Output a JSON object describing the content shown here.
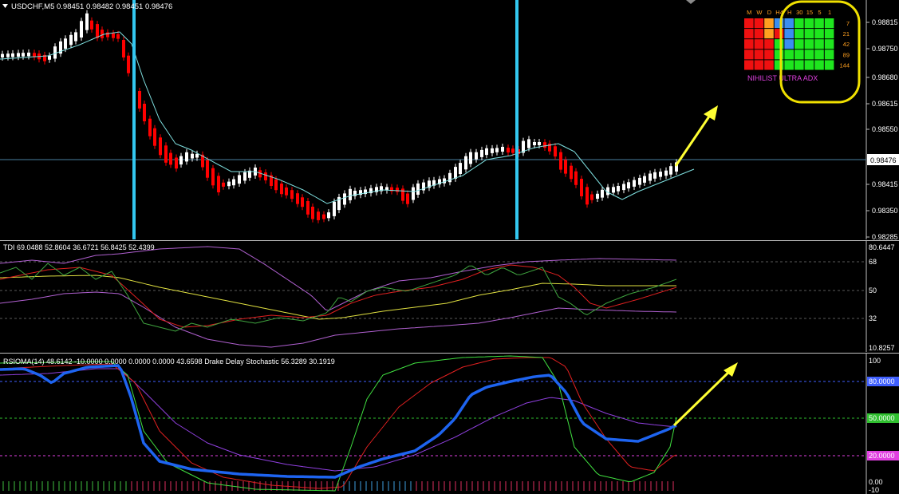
{
  "main": {
    "title": "USDCHF,M5  0.98451 0.98482 0.98451 0.98476",
    "price_labels": [
      "0.98815",
      "0.98750",
      "0.98680",
      "0.98615",
      "0.98550",
      "0.98415",
      "0.98350",
      "0.98285"
    ],
    "current_price": "0.98476"
  },
  "matrix": {
    "timeframes": [
      "M",
      "W",
      "D",
      "H4",
      "H",
      "30",
      "15",
      "5",
      "1"
    ],
    "row_labels": [
      "7",
      "21",
      "42",
      "89",
      "144"
    ],
    "cells": [
      [
        "red",
        "red",
        "orange",
        "blue",
        "blue",
        "green",
        "green",
        "green",
        "green"
      ],
      [
        "red",
        "red",
        "orange",
        "red",
        "blue",
        "green",
        "green",
        "green",
        "green"
      ],
      [
        "red",
        "red",
        "red",
        "green",
        "blue",
        "green",
        "green",
        "green",
        "green"
      ],
      [
        "red",
        "red",
        "red",
        "green",
        "green",
        "green",
        "green",
        "green",
        "green"
      ],
      [
        "red",
        "red",
        "red",
        "green",
        "green",
        "green",
        "green",
        "green",
        "green"
      ]
    ],
    "label": "NIHILIST ULTRA ADX"
  },
  "tdi": {
    "title": "TDI 69.0488 52.8604 36.6721 56.8425 52.4399",
    "levels": [
      "80.6447",
      "68",
      "50",
      "32",
      "10.8257"
    ]
  },
  "rsi": {
    "title": "RSIOMA(14) 48.6142 -10.0000 0.0000 0.0000 0.0000 43.6598  Drake Delay Stochastic 56.3289 30.1919",
    "levels": [
      "100",
      "80.0000",
      "50.0000",
      "20.0000",
      "0.00",
      "-10"
    ]
  },
  "colors": {
    "bull": "#ffffff",
    "bear": "#ff0000",
    "ma": "#7fe0e0",
    "vline": "#33c7f0",
    "arrow": "#ffff33",
    "highlight": "#f0e000",
    "cell_red": "#f01010",
    "cell_orange": "#ffa020",
    "cell_blue": "#3a8ef0",
    "cell_green": "#1ee61e",
    "tdi_green": "#3fa43f",
    "tdi_red": "#e02020",
    "tdi_yellow": "#e0e040",
    "tdi_band": "#b060d0",
    "rsi_blue": "#1e64f0",
    "stoch_green": "#40e040",
    "stoch_red": "#e02020",
    "rsi_purple": "#9040e0"
  }
}
